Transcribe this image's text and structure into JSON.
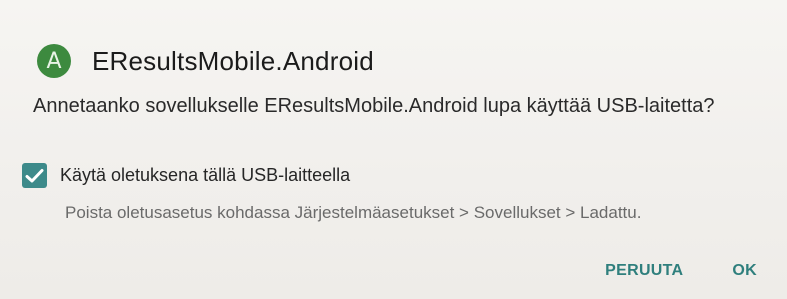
{
  "dialog": {
    "app_icon_letter": "A",
    "title": "EResultsMobile.Android",
    "message": "Annetaanko sovellukselle EResultsMobile.Android lupa käyttää USB-laitetta?",
    "checkbox": {
      "label": "Käytä oletuksena tällä USB-laitteella",
      "checked": true
    },
    "hint": "Poista oletusasetus kohdassa Järjestelmäasetukset > Sovellukset > Ladattu.",
    "buttons": {
      "cancel": "PERUUTA",
      "ok": "OK"
    }
  },
  "colors": {
    "accent": "#2f7f7d",
    "icon_bg": "#3d8a3f",
    "checkbox_bg": "#3d8a8a"
  }
}
